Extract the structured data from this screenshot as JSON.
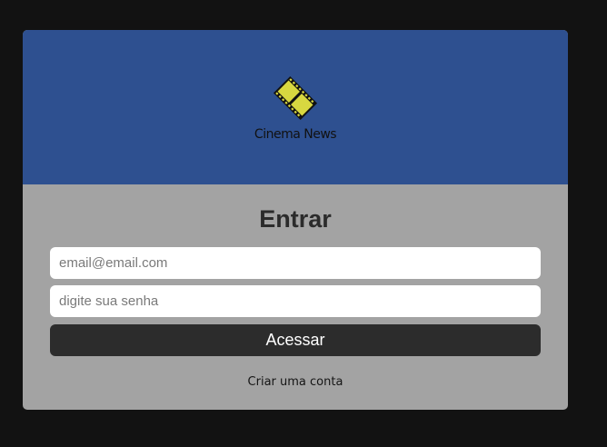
{
  "brand": {
    "name": "Cinema News",
    "icon": "film-strip-icon",
    "icon_fill": "#d8d840"
  },
  "colors": {
    "page_background": "#121212",
    "header_background": "#2e5090",
    "form_background": "#a3a3a3",
    "button_background": "#2c2c2c"
  },
  "login": {
    "title": "Entrar",
    "email_placeholder": "email@email.com",
    "password_placeholder": "digite sua senha",
    "submit_label": "Acessar",
    "signup_link": "Criar uma conta"
  }
}
